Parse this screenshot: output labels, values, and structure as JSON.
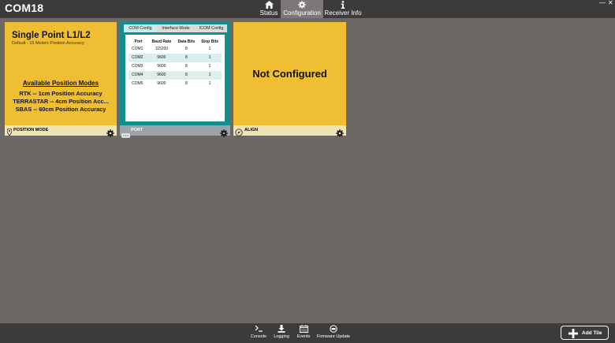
{
  "app": {
    "title": "COM18"
  },
  "nav": [
    {
      "label": "Status",
      "icon": "home-icon",
      "active": false
    },
    {
      "label": "Configuration",
      "icon": "gear-icon",
      "active": true
    },
    {
      "label": "Receiver Info",
      "icon": "info-icon",
      "active": false
    }
  ],
  "window_controls": {
    "minimize": "—",
    "close": "✕"
  },
  "tiles": {
    "position": {
      "title": "Single Point L1/L2",
      "subtitle": "Default - 15 Meters Position Accuracy",
      "modes_heading": "Available Position Modes",
      "modes": [
        "RTK -- 1cm Position Accuracy",
        "TERRASTAR -- 4cm Position Acc...",
        "SBAS -- 60cm Position Accuracy"
      ],
      "footer_label": "POSITION MODE",
      "color": "#f0be32"
    },
    "port": {
      "tabs": [
        "COM Config",
        "Interface Mode",
        "ICOM Config"
      ],
      "columns": [
        "Port",
        "Baud Rate",
        "Data Bits",
        "Stop Bits"
      ],
      "rows": [
        [
          "COM1",
          "115200",
          "8",
          "1"
        ],
        [
          "COM2",
          "9600",
          "8",
          "1"
        ],
        [
          "COM3",
          "9600",
          "8",
          "1"
        ],
        [
          "COM4",
          "9600",
          "8",
          "1"
        ],
        [
          "COM5",
          "9600",
          "8",
          "1"
        ]
      ],
      "footer_label": "PORT",
      "color": "#138e8e"
    },
    "align": {
      "status": "Not Configured",
      "footer_label": "ALIGN",
      "color": "#f0be32"
    }
  },
  "bottom_bar": [
    {
      "label": "Console",
      "icon": "console-icon"
    },
    {
      "label": "Logging",
      "icon": "download-icon"
    },
    {
      "label": "Events",
      "icon": "calendar-icon"
    },
    {
      "label": "Firmware Update",
      "icon": "firmware-icon"
    }
  ],
  "add_tile": {
    "label": "Add Tile"
  }
}
